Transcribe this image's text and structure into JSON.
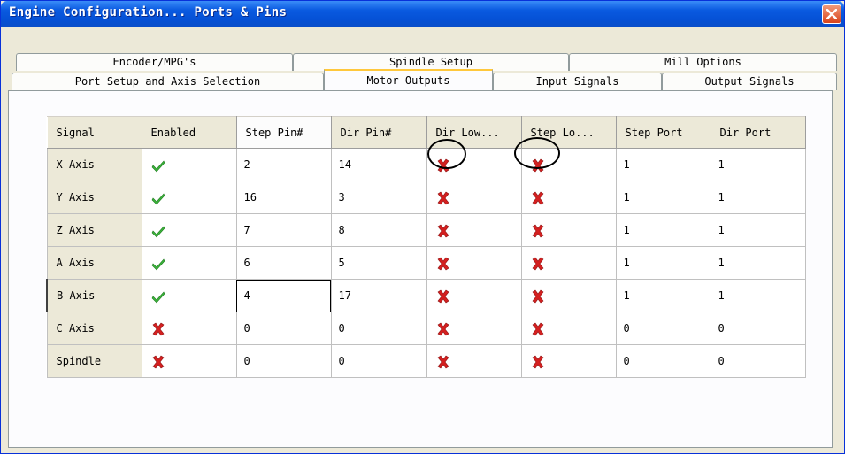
{
  "window": {
    "title": "Engine Configuration... Ports & Pins",
    "close_icon": "close-icon",
    "colors": {
      "titlebar": "#0a5ae0",
      "face": "#ece9d8",
      "close": "#d9441c"
    }
  },
  "tabs": {
    "back_row": [
      "Encoder/MPG's",
      "Spindle Setup",
      "Mill Options"
    ],
    "front_row": [
      "Port Setup and Axis Selection",
      "Motor Outputs",
      "Input Signals",
      "Output Signals"
    ],
    "selected": "Motor Outputs"
  },
  "table": {
    "columns": [
      "Signal",
      "Enabled",
      "Step Pin#",
      "Dir Pin#",
      "Dir Low...",
      "Step Lo...",
      "Step Port",
      "Dir Port"
    ],
    "rows": [
      {
        "signal": "X Axis",
        "enabled": "check-icon",
        "step_pin": "2",
        "dir_pin": "14",
        "dir_low": "x-icon",
        "step_low": "x-icon",
        "step_port": "1",
        "dir_port": "1"
      },
      {
        "signal": "Y Axis",
        "enabled": "check-icon",
        "step_pin": "16",
        "dir_pin": "3",
        "dir_low": "x-icon",
        "step_low": "x-icon",
        "step_port": "1",
        "dir_port": "1"
      },
      {
        "signal": "Z Axis",
        "enabled": "check-icon",
        "step_pin": "7",
        "dir_pin": "8",
        "dir_low": "x-icon",
        "step_low": "x-icon",
        "step_port": "1",
        "dir_port": "1"
      },
      {
        "signal": "A Axis",
        "enabled": "check-icon",
        "step_pin": "6",
        "dir_pin": "5",
        "dir_low": "x-icon",
        "step_low": "x-icon",
        "step_port": "1",
        "dir_port": "1"
      },
      {
        "signal": "B Axis",
        "enabled": "check-icon",
        "step_pin": "4",
        "dir_pin": "17",
        "dir_low": "x-icon",
        "step_low": "x-icon",
        "step_port": "1",
        "dir_port": "1"
      },
      {
        "signal": "C Axis",
        "enabled": "x-icon",
        "step_pin": "0",
        "dir_pin": "0",
        "dir_low": "x-icon",
        "step_low": "x-icon",
        "step_port": "0",
        "dir_port": "0"
      },
      {
        "signal": "Spindle",
        "enabled": "x-icon",
        "step_pin": "0",
        "dir_pin": "0",
        "dir_low": "x-icon",
        "step_low": "x-icon",
        "step_port": "0",
        "dir_port": "0"
      }
    ],
    "focused_cell": "B Axis / Step Pin#",
    "icon_colors": {
      "check": "#3cb43c",
      "x": "#d42020"
    }
  }
}
